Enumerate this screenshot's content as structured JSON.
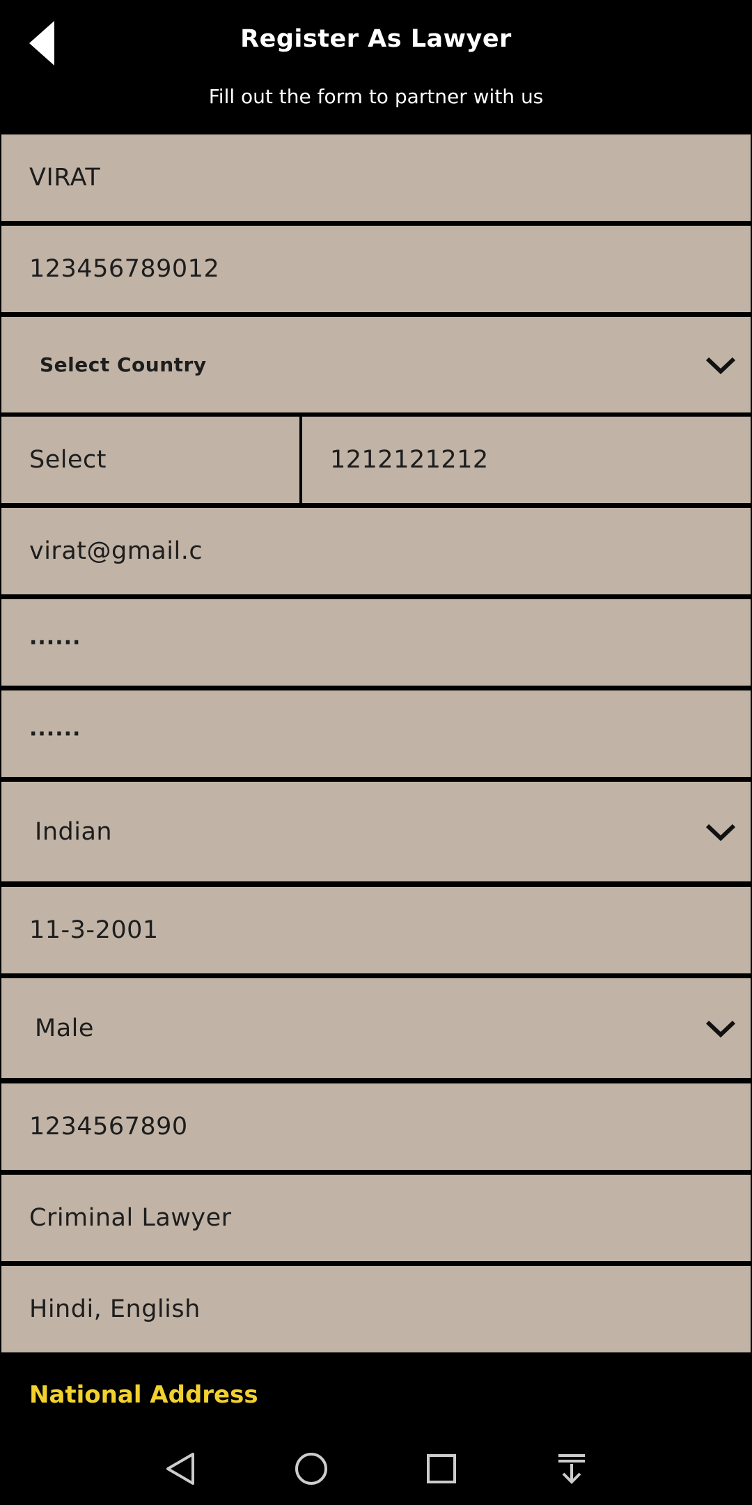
{
  "header": {
    "title": "Register As Lawyer",
    "subtitle": "Fill out the form to partner with us",
    "back_icon": "back-arrow-icon"
  },
  "form": {
    "name": "VIRAT",
    "id_number": "123456789012",
    "country": "Select Country",
    "country_code": "Select",
    "phone": "1212121212",
    "email": "virat@gmail.c",
    "password": "······",
    "confirm_password": "······",
    "nationality": "Indian",
    "dob": "11-3-2001",
    "gender": "Male",
    "license_number": "1234567890",
    "specialization": "Criminal Lawyer",
    "languages": "Hindi, English"
  },
  "section": {
    "national_address": "National Address"
  },
  "colors": {
    "field_bg": "#c1b4a7",
    "background": "#000000",
    "accent_yellow": "#f2d12e"
  },
  "navbar": {
    "icons": [
      "back-triangle-icon",
      "home-circle-icon",
      "recents-square-icon",
      "notifications-pull-icon"
    ]
  }
}
